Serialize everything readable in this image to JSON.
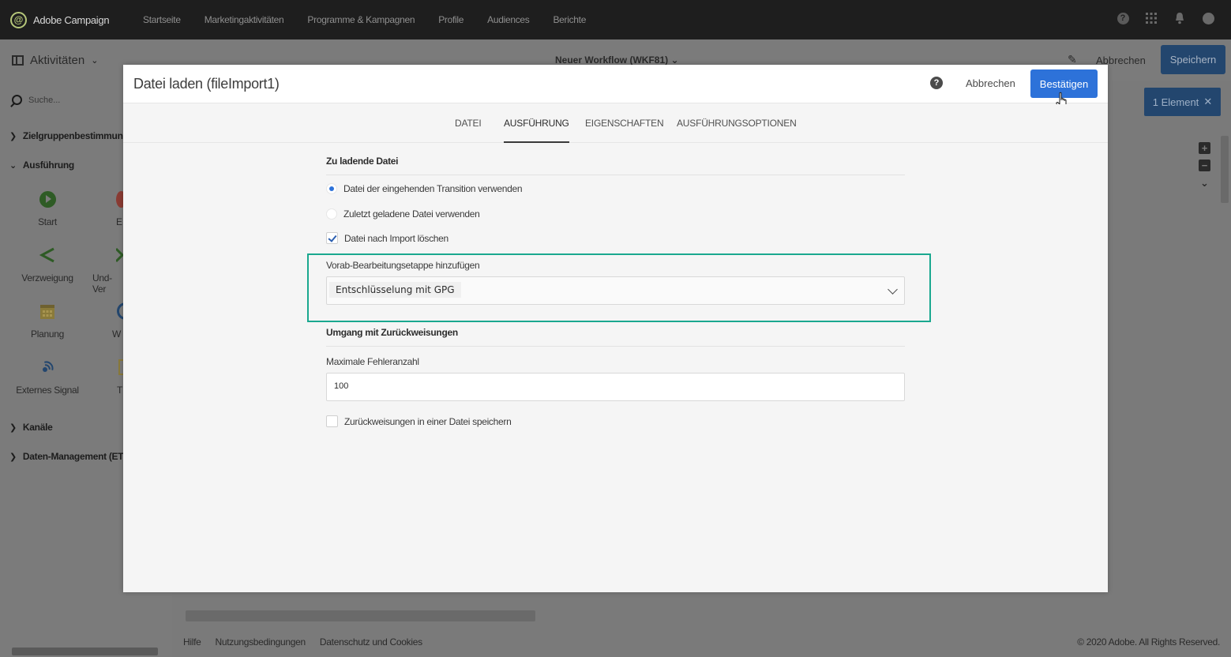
{
  "topbar": {
    "app_name": "Adobe Campaign",
    "nav": [
      "Startseite",
      "Marketingaktivitäten",
      "Programme & Kampagnen",
      "Profile",
      "Audiences",
      "Berichte"
    ]
  },
  "workflow": {
    "panel_label": "Aktivitäten",
    "title": "Neuer Workflow (WKF81)",
    "cancel": "Abbrechen",
    "save": "Speichern",
    "selection": "1 Element"
  },
  "sidebar": {
    "search_placeholder": "Suche...",
    "categories": {
      "targeting": "Zielgruppenbestimmung",
      "execution": "Ausführung",
      "channels": "Kanäle",
      "data_management": "Daten-Management (ETL)"
    },
    "activities": {
      "start": "Start",
      "end_partial": "E",
      "branch": "Verzweigung",
      "and_join_partial": "Und-Ver",
      "scheduler": "Planung",
      "wait_partial": "W",
      "external_signal": "Externes Signal",
      "test_partial": "T"
    }
  },
  "modal": {
    "title": "Datei laden (fileImport1)",
    "cancel": "Abbrechen",
    "confirm": "Bestätigen",
    "tabs": [
      "DATEI",
      "AUSFÜHRUNG",
      "EIGENSCHAFTEN",
      "AUSFÜHRUNGSOPTIONEN"
    ],
    "active_tab": "AUSFÜHRUNG",
    "file_section": {
      "title": "Zu ladende Datei",
      "option_transition": "Datei der eingehenden Transition verwenden",
      "option_last": "Zuletzt geladene Datei verwenden",
      "delete_after_import": "Datei nach Import löschen"
    },
    "preprocessing": {
      "label": "Vorab-Bearbeitungsetappe hinzufügen",
      "value": "Entschlüsselung mit GPG"
    },
    "rejects_section": {
      "title": "Umgang mit Zurückweisungen",
      "max_errors_label": "Maximale Fehleranzahl",
      "max_errors_value": "100",
      "save_rejects": "Zurückweisungen in einer Datei speichern"
    }
  },
  "footer": {
    "links": [
      "Hilfe",
      "Nutzungsbedingungen",
      "Datenschutz und Cookies"
    ],
    "copyright": "© 2020 Adobe. All Rights Reserved."
  },
  "colors": {
    "accent": "#2d72d9",
    "highlight": "#1aa88f",
    "topbar": "#1e1e1e"
  }
}
